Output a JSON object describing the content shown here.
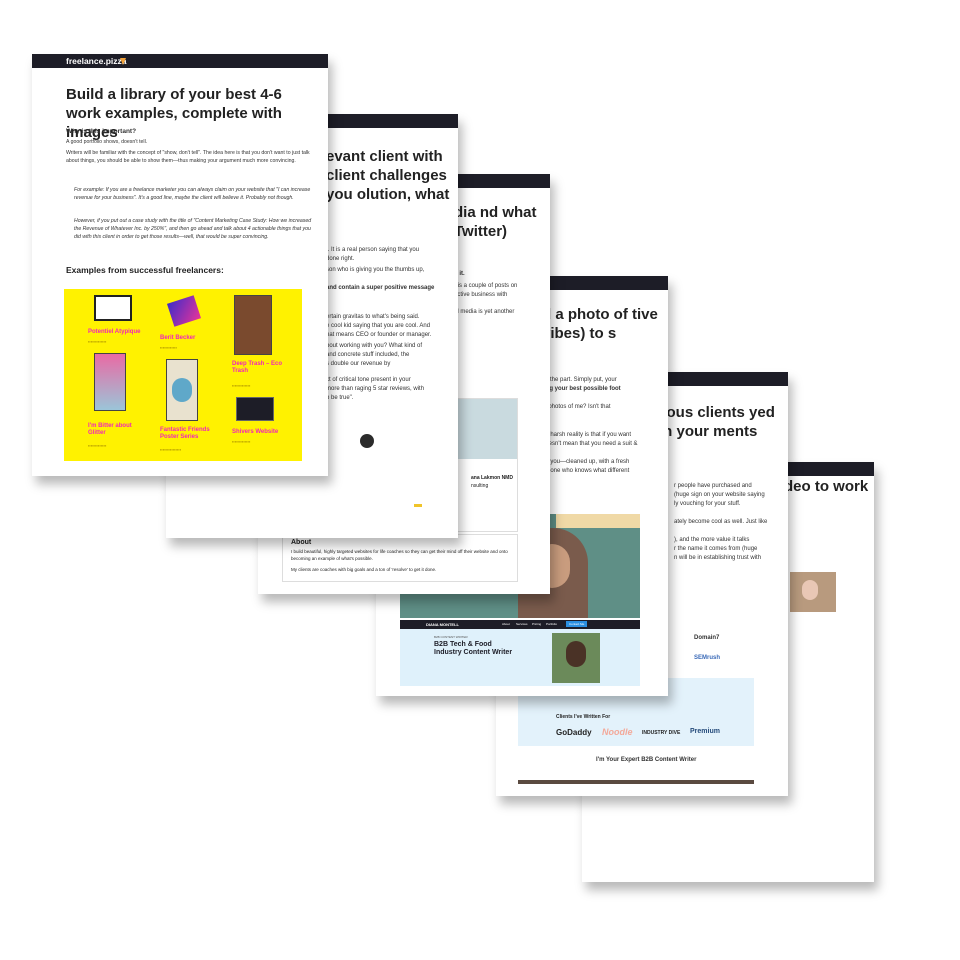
{
  "card1": {
    "brand": "freelance.pizza",
    "brand_icon": "pizza-slice-icon",
    "title": "Build a library of your best 4-6 work examples, complete with images",
    "why_heading": "Why is this important?",
    "p1": "A good portfolio shows, doesn't tell.",
    "p2": "Writers will be familiar with the concept of \"show, don't tell\". The idea here is that you don't want to just talk about things, you should be able to show them—thus making your argument much more convincing.",
    "quote1": "For example: If you are a freelance marketer you can always claim on your website that \"I can increase revenue for your business\". It's a good line, maybe the client will believe it. Probably not though.",
    "quote2": "However, if you put out a case study with the title of \"Content Marketing Case Study: How we increased the Revenue of Whatever Inc. by 250%\", and then go ahead and talk about 4 actionable things that you did with this client in order to get those results—well, that would be super convincing.",
    "examples_heading": "Examples from successful freelancers:",
    "items": [
      {
        "label": "Potentiel Atypique"
      },
      {
        "label": "Berit Becker"
      },
      {
        "label": "Deep Trash – Eco Trash"
      },
      {
        "label": "I'm Bitter about Glitter"
      },
      {
        "label": "Fantastic Friends Poster Series"
      },
      {
        "label": "Shivers Website"
      }
    ]
  },
  "card2": {
    "title": "evant client with client challenges you olution, what",
    "l1": "f. It is a real person saying that you",
    "l2": "done right.",
    "l3": "son who is giving you the thumbs up,",
    "l4": "and contain a super positive message",
    "l5": "ertain gravitas to what's being said.",
    "l6": "e cool kid saying that you are cool. And",
    "l7": "hat means CEO or founder or manager.",
    "l8": "bout working with you? What kind of",
    "l9": "and concrete stuff included, the",
    "l10": "s double our revenue by",
    "l11": "xt of critical tone present in your",
    "l12": "more than raging 5 star reviews, with",
    "l13": "o be true\"."
  },
  "card3": {
    "title": "dia nd what Twitter)",
    "l1": "d it.",
    "l2": "r is a couple of posts on",
    "l3": "active business with",
    "l4": "al media is yet another",
    "name": "ana Lakmon NMD",
    "role": "nsulting",
    "about_heading": "About",
    "about1": "I build beautiful, highly targeted websites for life coaches so they can get their mind off their website and onto becoming an example of what's possible.",
    "about2": "My clients are coaches with big goals and a ton of 'resolve' to get it done."
  },
  "card4": {
    "title": "d a photo of tive vibes) to s",
    "l1": "ok the part. Simply put, your",
    "l2": "ting your best possible foot",
    "l3": "al photos of me? Isn't that",
    "l4": "he harsh reality is that if you want",
    "l5": "doesn't mean that you need a suit &",
    "l6": "t... you—cleaned up, with a fresh",
    "l7": "meone who knows what different",
    "brand": "DIANA MONTELL",
    "nav": [
      "About",
      "Services",
      "Pricing",
      "Portfolio"
    ],
    "nav_cta": "Contact Me",
    "kicker": "B2B CONTENT WRITER",
    "headline": "B2B Tech & Food Industry Content Writer"
  },
  "card5": {
    "title": "vious clients yed on your ments",
    "l1": "r people have purchased and",
    "l2": "(huge sign on your website saying",
    "l3": "ly vouching for your stuff.",
    "l4": "ately become cool as well. Just like",
    "l5": "), and the more value it talks",
    "l6": "r the name it comes from (huge",
    "l7": "n will be in establishing trust with",
    "clients_heading": "Clients I've Written For",
    "logos": [
      "GoDaddy",
      "Noodle",
      "INDUSTRY DIVE",
      "Premium"
    ],
    "logos_right": [
      "Domain7",
      "SEMrush"
    ],
    "expert_heading": "I'm Your Expert B2B Content Writer"
  },
  "card6": {
    "title": "deo to work"
  }
}
